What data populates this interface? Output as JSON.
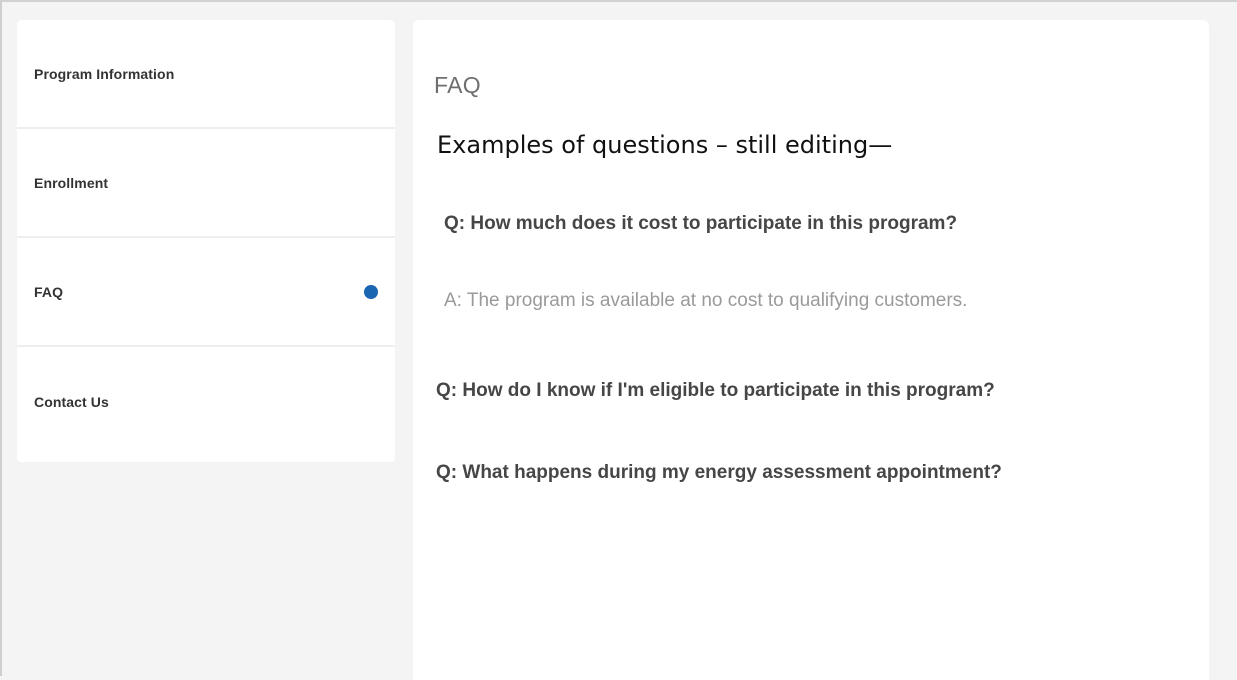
{
  "sidebar": {
    "items": [
      {
        "label": "Program Information",
        "active": false
      },
      {
        "label": "Enrollment",
        "active": false
      },
      {
        "label": "FAQ",
        "active": true
      },
      {
        "label": "Contact Us",
        "active": false
      }
    ],
    "active_indicator_icon": "dot-icon"
  },
  "main": {
    "title": "FAQ",
    "note": "Examples of questions – still editing—",
    "faqs": [
      {
        "question": "Q: How much does it cost to participate in this program?",
        "answer": "A: The program is available at no cost to qualifying customers."
      },
      {
        "question": "Q: How do I know if I'm eligible to participate in this program?"
      },
      {
        "question": "Q: What happens during my energy assessment appointment?"
      }
    ]
  },
  "colors": {
    "page_background": "#f4f4f4",
    "card_background": "#ffffff",
    "active_dot": "#1a66b3",
    "question_text": "#464646",
    "answer_text": "#9a9a9a",
    "title_text": "#6f6f6f"
  }
}
